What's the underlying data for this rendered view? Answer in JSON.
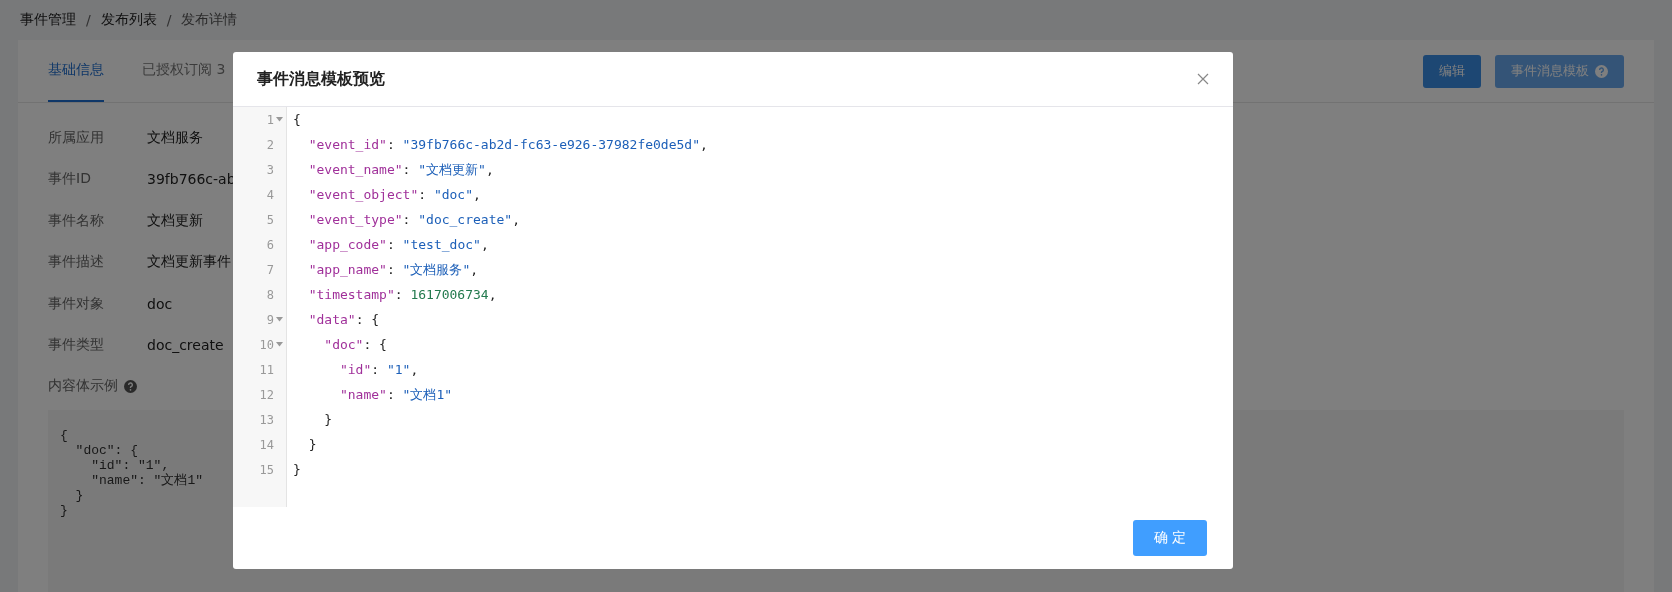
{
  "breadcrumb": [
    {
      "label": "事件管理"
    },
    {
      "separator": "/",
      "label": "发布列表"
    },
    {
      "separator": "/",
      "label": "发布详情"
    }
  ],
  "tabs": [
    {
      "label": "基础信息",
      "selected": true
    },
    {
      "label": "已授权订阅 3",
      "selected": false
    }
  ],
  "actions": [
    {
      "label": "编辑",
      "kind": "primary"
    },
    {
      "label": "事件消息模板",
      "kind": "help"
    }
  ],
  "fields": [
    {
      "label": "所属应用",
      "value": "文档服务"
    },
    {
      "label": "事件ID",
      "value": "39fb766c-ab"
    },
    {
      "label": "事件名称",
      "value": "文档更新"
    },
    {
      "label": "事件描述",
      "value": "文档更新事件"
    },
    {
      "label": "事件对象",
      "value": "doc"
    },
    {
      "label": "事件类型",
      "value": "doc_create"
    }
  ],
  "sample": {
    "label": "内容体示例",
    "lines": [
      "{",
      "  \"doc\": {",
      "    \"id\": \"1\",",
      "    \"name\": \"文档1\"",
      "  }",
      "}"
    ]
  },
  "modal": {
    "title": "事件消息模板预览",
    "confirm": "确 定",
    "code": [
      {
        "number": "1",
        "tokens": [
          {
            "kind": "punct",
            "text": "{"
          }
        ],
        "children": [
          {
            "number": "2",
            "tokens": [
              {
                "kind": "key",
                "text": "\"event_id\""
              },
              {
                "kind": "punct",
                "text": ": "
              },
              {
                "kind": "string",
                "text": "\"39fb766c-ab2d-fc63-e926-37982fe0de5d\""
              },
              {
                "kind": "punct",
                "text": ","
              }
            ]
          },
          {
            "number": "3",
            "tokens": [
              {
                "kind": "key",
                "text": "\"event_name\""
              },
              {
                "kind": "punct",
                "text": ": "
              },
              {
                "kind": "string",
                "text": "\"文档更新\""
              },
              {
                "kind": "punct",
                "text": ","
              }
            ]
          },
          {
            "number": "4",
            "tokens": [
              {
                "kind": "key",
                "text": "\"event_object\""
              },
              {
                "kind": "punct",
                "text": ": "
              },
              {
                "kind": "string",
                "text": "\"doc\""
              },
              {
                "kind": "punct",
                "text": ","
              }
            ]
          },
          {
            "number": "5",
            "tokens": [
              {
                "kind": "key",
                "text": "\"event_type\""
              },
              {
                "kind": "punct",
                "text": ": "
              },
              {
                "kind": "string",
                "text": "\"doc_create\""
              },
              {
                "kind": "punct",
                "text": ","
              }
            ]
          },
          {
            "number": "6",
            "tokens": [
              {
                "kind": "key",
                "text": "\"app_code\""
              },
              {
                "kind": "punct",
                "text": ": "
              },
              {
                "kind": "string",
                "text": "\"test_doc\""
              },
              {
                "kind": "punct",
                "text": ","
              }
            ]
          },
          {
            "number": "7",
            "tokens": [
              {
                "kind": "key",
                "text": "\"app_name\""
              },
              {
                "kind": "punct",
                "text": ": "
              },
              {
                "kind": "string",
                "text": "\"文档服务\""
              },
              {
                "kind": "punct",
                "text": ","
              }
            ]
          },
          {
            "number": "8",
            "tokens": [
              {
                "kind": "key",
                "text": "\"timestamp\""
              },
              {
                "kind": "punct",
                "text": ": "
              },
              {
                "kind": "number",
                "text": "1617006734"
              },
              {
                "kind": "punct",
                "text": ","
              }
            ]
          },
          {
            "number": "9",
            "tokens": [
              {
                "kind": "key",
                "text": "\"data\""
              },
              {
                "kind": "punct",
                "text": ": {"
              }
            ],
            "children": [
              {
                "number": "10",
                "tokens": [
                  {
                    "kind": "key",
                    "text": "\"doc\""
                  },
                  {
                    "kind": "punct",
                    "text": ": {"
                  }
                ],
                "children": [
                  {
                    "number": "11",
                    "tokens": [
                      {
                        "kind": "key",
                        "text": "\"id\""
                      },
                      {
                        "kind": "punct",
                        "text": ": "
                      },
                      {
                        "kind": "string",
                        "text": "\"1\""
                      },
                      {
                        "kind": "punct",
                        "text": ","
                      }
                    ]
                  },
                  {
                    "number": "12",
                    "tokens": [
                      {
                        "kind": "key",
                        "text": "\"name\""
                      },
                      {
                        "kind": "punct",
                        "text": ": "
                      },
                      {
                        "kind": "string",
                        "text": "\"文档1\""
                      }
                    ]
                  }
                ],
                "end": {
                  "number": "13",
                  "kind": "punct",
                  "text": "}"
                }
              }
            ],
            "end": {
              "number": "14",
              "kind": "punct",
              "text": "}"
            }
          }
        ],
        "end": {
          "number": "15",
          "kind": "punct",
          "text": "}"
        }
      }
    ]
  }
}
